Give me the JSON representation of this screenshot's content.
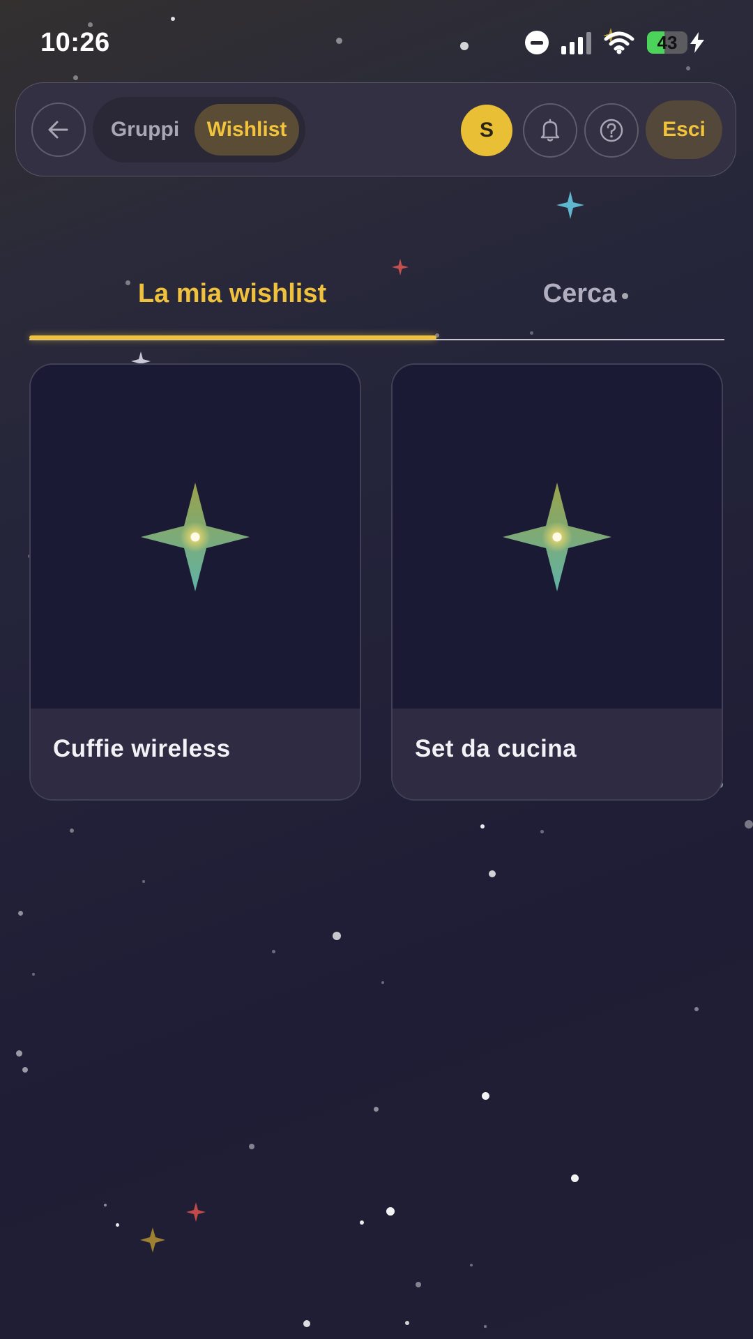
{
  "status_bar": {
    "time": "10:26",
    "battery": "43"
  },
  "header": {
    "segments": [
      {
        "label": "Gruppi"
      },
      {
        "label": "Wishlist"
      }
    ],
    "avatar_initial": "S",
    "logout_label": "Esci"
  },
  "tabs": [
    {
      "label": "La mia wishlist"
    },
    {
      "label": "Cerca"
    }
  ],
  "items": [
    {
      "name": "Cuffie wireless"
    },
    {
      "name": "Set da cucina"
    }
  ],
  "colors": {
    "accent": "#efc13d",
    "background": "#1f1d35",
    "card": "#2e2b42"
  },
  "icons": [
    "arrow-left-icon",
    "bell-icon",
    "help-circle-icon",
    "sparkle-icon",
    "wifi-icon",
    "signal-icon",
    "do-not-disturb-icon",
    "charging-bolt-icon"
  ]
}
